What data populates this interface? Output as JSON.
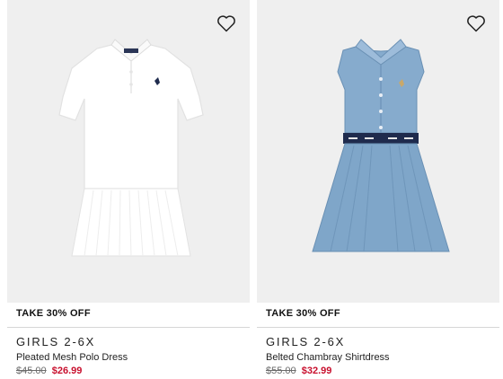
{
  "products": [
    {
      "promo": "TAKE 30% OFF",
      "brand": "GIRLS 2-6X",
      "name": "Pleated Mesh Polo Dress",
      "was_price": "$45.00",
      "sale_price": "$26.99",
      "image": "white-polo-dress"
    },
    {
      "promo": "TAKE 30% OFF",
      "brand": "GIRLS 2-6X",
      "name": "Belted Chambray Shirtdress",
      "was_price": "$55.00",
      "sale_price": "$32.99",
      "image": "chambray-shirtdress"
    }
  ],
  "colors": {
    "sale": "#c8102e",
    "image_bg": "#efefef",
    "chambray": "#7fa6c9",
    "belt_navy": "#1f2b4d"
  },
  "icons": [
    "heart-outline-icon"
  ]
}
